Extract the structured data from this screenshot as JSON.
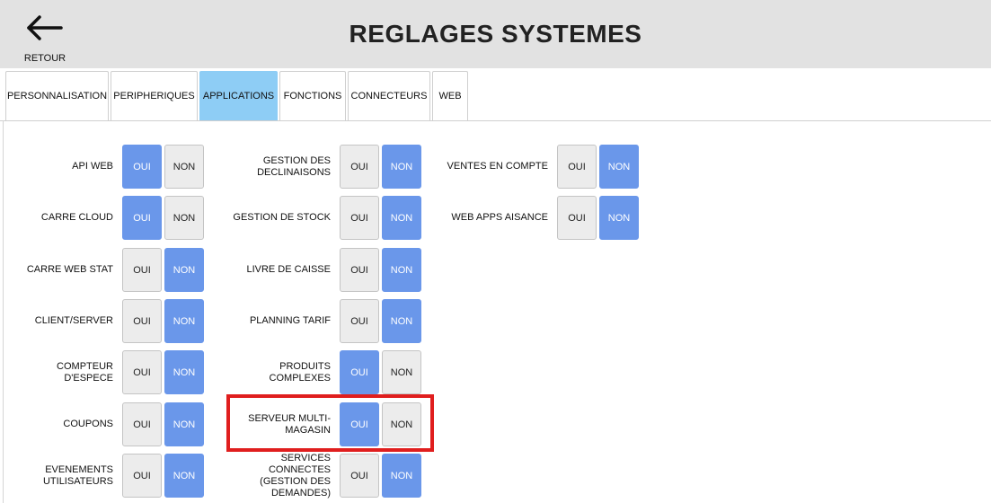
{
  "header": {
    "back_label": "RETOUR",
    "title": "REGLAGES SYSTEMES"
  },
  "tabs": [
    {
      "label": "PERSONNALISATION",
      "active": false
    },
    {
      "label": "PERIPHERIQUES",
      "active": false
    },
    {
      "label": "APPLICATIONS",
      "active": true
    },
    {
      "label": "FONCTIONS",
      "active": false
    },
    {
      "label": "CONNECTEURS",
      "active": false
    },
    {
      "label": "WEB",
      "active": false
    }
  ],
  "toggle_labels": {
    "yes": "OUI",
    "no": "NON"
  },
  "settings": {
    "col1": [
      {
        "label": "API WEB",
        "value": "OUI"
      },
      {
        "label": "CARRE CLOUD",
        "value": "OUI"
      },
      {
        "label": "CARRE WEB STAT",
        "value": "NON"
      },
      {
        "label": "CLIENT/SERVER",
        "value": "NON"
      },
      {
        "label": "COMPTEUR D'ESPECE",
        "value": "NON"
      },
      {
        "label": "COUPONS",
        "value": "NON"
      },
      {
        "label": "EVENEMENTS UTILISATEURS",
        "value": "NON"
      }
    ],
    "col2": [
      {
        "label": "GESTION DES DECLINAISONS",
        "value": "NON"
      },
      {
        "label": "GESTION DE STOCK",
        "value": "NON"
      },
      {
        "label": "LIVRE DE CAISSE",
        "value": "NON"
      },
      {
        "label": "PLANNING TARIF",
        "value": "NON"
      },
      {
        "label": "PRODUITS COMPLEXES",
        "value": "OUI"
      },
      {
        "label": "SERVEUR MULTI-MAGASIN",
        "value": "OUI"
      },
      {
        "label": "SERVICES CONNECTES (GESTION DES DEMANDES)",
        "value": "NON"
      }
    ],
    "col3": [
      {
        "label": "VENTES EN COMPTE",
        "value": "NON"
      },
      {
        "label": "WEB APPS AISANCE",
        "value": "NON"
      }
    ]
  },
  "colors": {
    "active_toggle": "#6a97ea",
    "inactive_toggle": "#ececec",
    "active_tab": "#8ecdf5",
    "highlight_box": "#e01e1e"
  }
}
